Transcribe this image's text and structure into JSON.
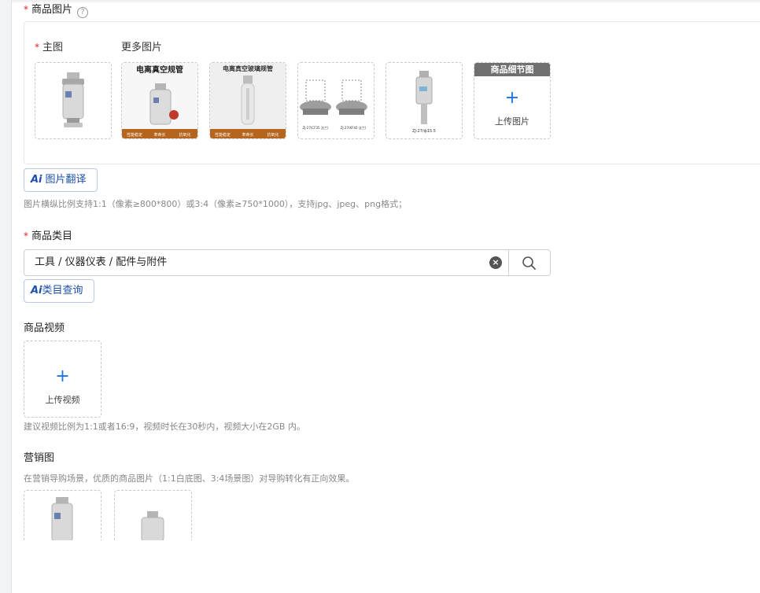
{
  "product_images": {
    "label": "商品图片",
    "required_mark": "*",
    "help_icon": "?",
    "main_label": "主图",
    "more_label": "更多图片",
    "thumbs": [
      {
        "name": "main-image",
        "caption": ""
      },
      {
        "name": "more-image-1",
        "title": "电离真空规管",
        "footer": [
          "性能稳定",
          "寿命长",
          "抗氧化"
        ]
      },
      {
        "name": "more-image-2",
        "title": "电离真空玻璃规管",
        "footer": [
          "性能稳定",
          "寿命长",
          "抗氧化"
        ]
      },
      {
        "name": "more-image-3",
        "captions": [
          "ZJ-27(CF35 法兰)",
          "ZJ-27(KF40 法兰)"
        ]
      },
      {
        "name": "more-image-4",
        "caption": "ZJ-27/ф15.5"
      }
    ],
    "detail_slot": {
      "header": "商品细节图",
      "plus": "+",
      "upload_text": "上传图片"
    },
    "translate_button": {
      "ai": "Ai",
      "label": "图片翻译"
    },
    "hint": "图片横纵比例支持1:1（像素≥800*800）或3:4（像素≥750*1000），支持jpg、jpeg、png格式；"
  },
  "category": {
    "label": "商品类目",
    "required_mark": "*",
    "value": "工具 / 仪器仪表 / 配件与附件",
    "clear_icon": "clear-icon",
    "search_icon": "search-icon",
    "query_button": {
      "ai": "Ai",
      "label": "类目查询"
    }
  },
  "video": {
    "label": "商品视频",
    "plus": "+",
    "upload_text": "上传视频",
    "hint": "建议视频比例为1:1或者16:9，视频时长在30秒内，视频大小在2GB 内。"
  },
  "marketing": {
    "label": "营销图",
    "hint": "在营销导购场景，优质的商品图片（1:1白底图、3:4场景图）对导购转化有正向效果。"
  },
  "colors": {
    "accent": "#1a73e8",
    "required": "#e02020",
    "ai_button_text": "#1d4fa8"
  }
}
